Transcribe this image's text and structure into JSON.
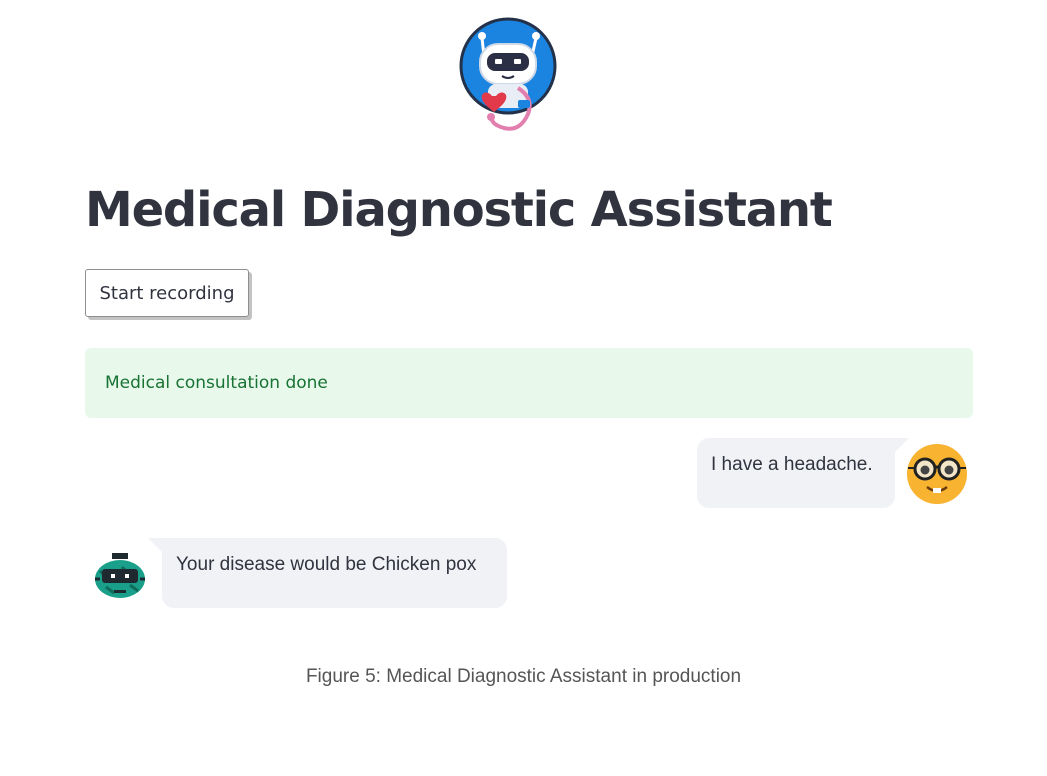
{
  "app": {
    "logo_icon": "medical-robot-icon",
    "title": "Medical Diagnostic Assistant"
  },
  "controls": {
    "record_label": "Start recording"
  },
  "status": {
    "message": "Medical consultation done",
    "color": "#177233",
    "background": "#e8f9ec"
  },
  "chat": {
    "messages": [
      {
        "role": "user",
        "text": "I have a headache.",
        "avatar_icon": "nerd-face-icon"
      },
      {
        "role": "bot",
        "text": "Your disease would be Chicken pox",
        "avatar_icon": "robot-avatar-icon"
      }
    ]
  },
  "caption": "Figure 5: Medical Diagnostic Assistant in production"
}
